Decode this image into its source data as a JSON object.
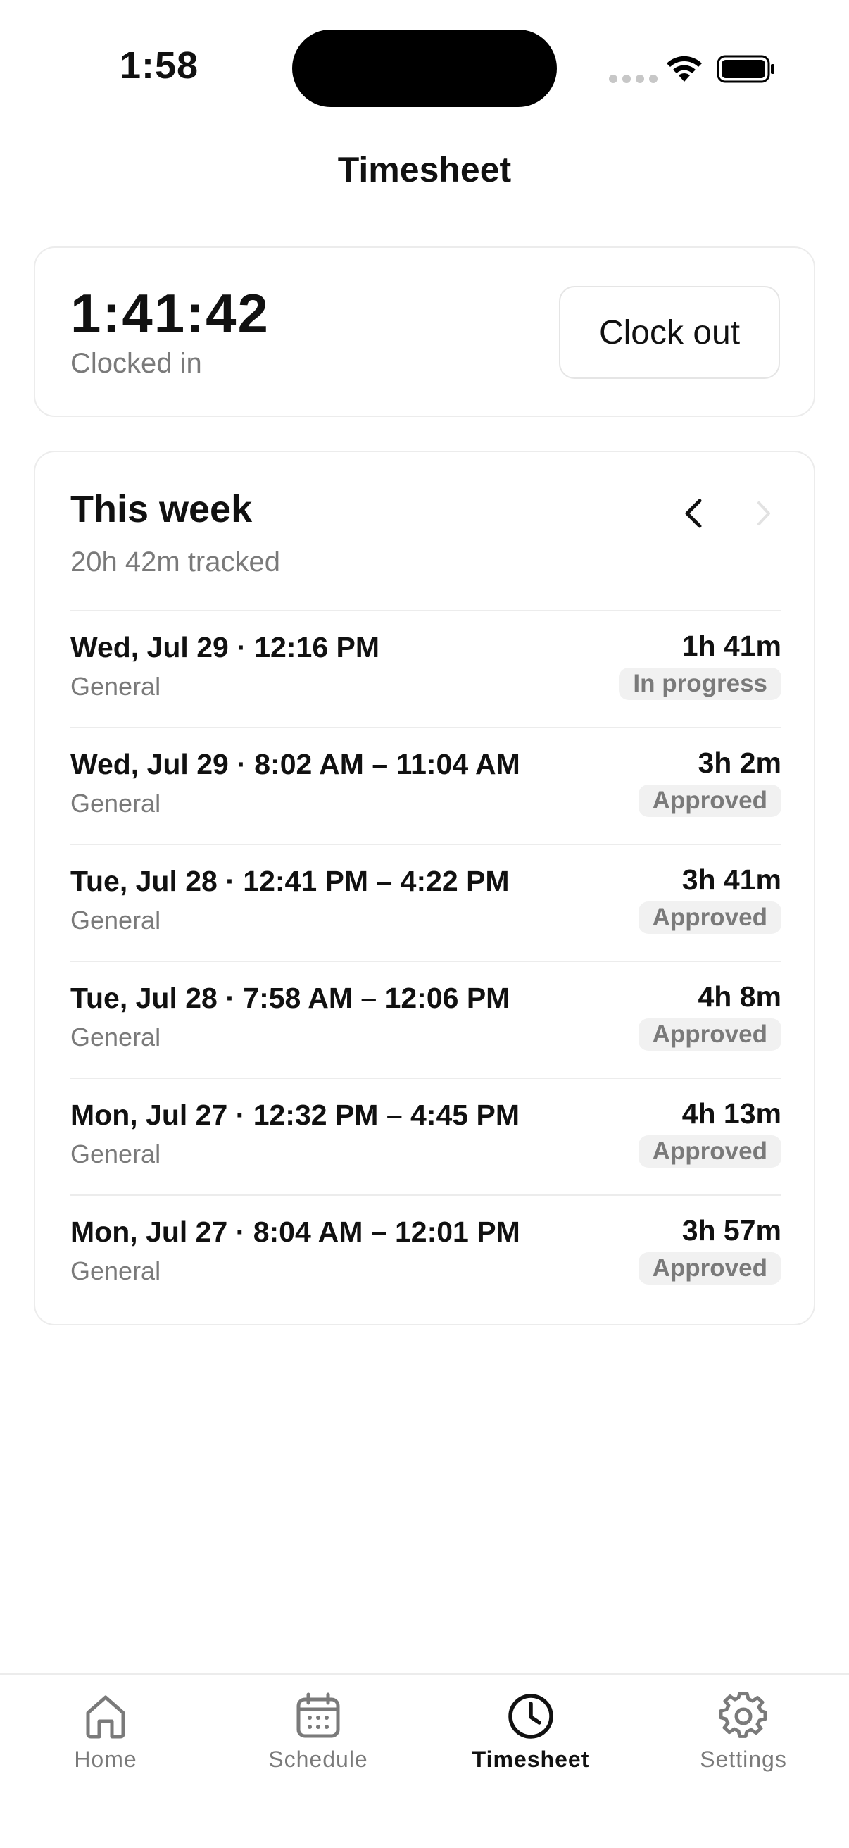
{
  "status_bar": {
    "time": "1:58"
  },
  "page": {
    "title": "Timesheet"
  },
  "timer": {
    "value": "1:41:42",
    "status": "Clocked in",
    "clock_out_label": "Clock out"
  },
  "week": {
    "title": "This week",
    "tracked": "20h 42m tracked",
    "entries": [
      {
        "date": "Wed, Jul 29 · 12:16 PM",
        "category": "General",
        "duration": "1h 41m",
        "status": "In progress"
      },
      {
        "date": "Wed, Jul 29 · 8:02 AM – 11:04 AM",
        "category": "General",
        "duration": "3h 2m",
        "status": "Approved"
      },
      {
        "date": "Tue, Jul 28 · 12:41 PM – 4:22 PM",
        "category": "General",
        "duration": "3h 41m",
        "status": "Approved"
      },
      {
        "date": "Tue, Jul 28 · 7:58 AM – 12:06 PM",
        "category": "General",
        "duration": "4h 8m",
        "status": "Approved"
      },
      {
        "date": "Mon, Jul 27 · 12:32 PM – 4:45 PM",
        "category": "General",
        "duration": "4h 13m",
        "status": "Approved"
      },
      {
        "date": "Mon, Jul 27 · 8:04 AM – 12:01 PM",
        "category": "General",
        "duration": "3h 57m",
        "status": "Approved"
      }
    ]
  },
  "tabs": [
    {
      "label": "Home",
      "icon": "home-icon"
    },
    {
      "label": "Schedule",
      "icon": "calendar-icon"
    },
    {
      "label": "Timesheet",
      "icon": "clock-icon",
      "active": true
    },
    {
      "label": "Settings",
      "icon": "gear-icon"
    }
  ],
  "colors": {
    "text": "#111111",
    "muted": "#7a7a7a",
    "border": "#ececec",
    "badge_bg": "#f1f1f1"
  }
}
